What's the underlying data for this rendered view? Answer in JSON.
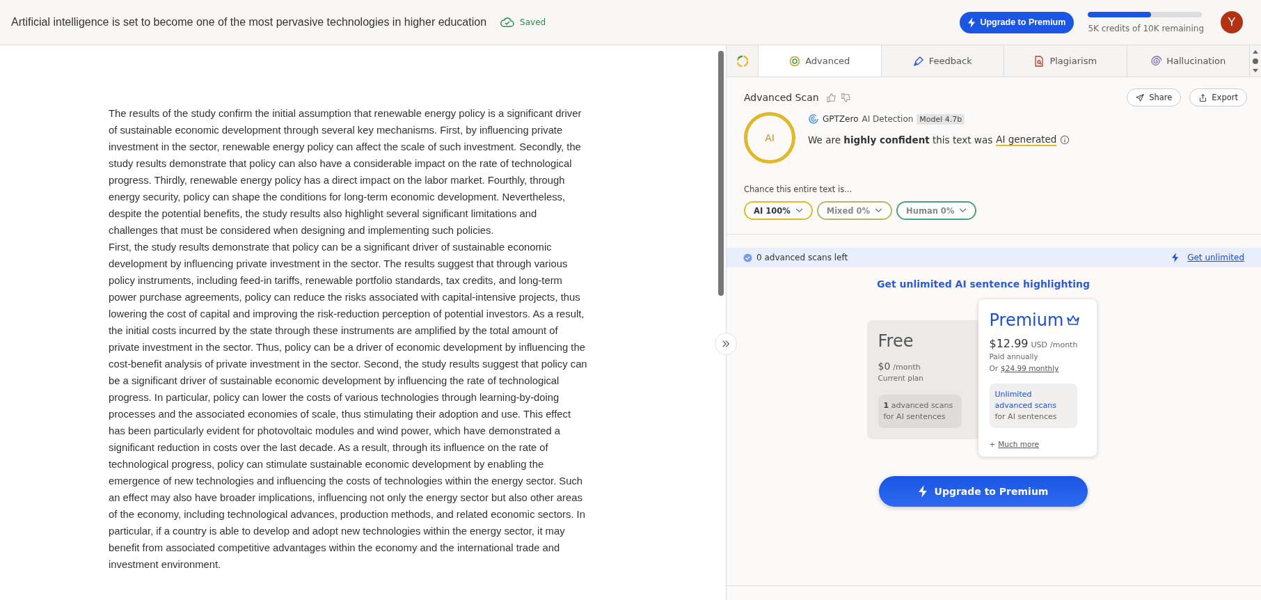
{
  "header": {
    "title": "Artificial intelligence is set to become one of the most pervasive technologies in higher education",
    "saved": "Saved",
    "upgrade": "Upgrade to Premium",
    "credits": {
      "level": 0.55,
      "label": "5K credits of 10K remaining"
    },
    "avatar": "Y"
  },
  "document": {
    "paragraphs": [
      "The results of the study confirm the initial assumption that renewable energy policy is a significant driver of sustainable economic development through several key mechanisms. First, by influencing private investment in the sector, renewable energy policy can affect the scale of such investment. Secondly, the study results demonstrate that policy can also have a considerable impact on the rate of technological progress. Thirdly, renewable energy policy has a direct impact on the labor market. Fourthly, through energy security, policy can shape the conditions for long-term economic development. Nevertheless, despite the potential benefits, the study results also highlight several significant limitations and challenges that must be considered when designing and implementing such policies.",
      "First, the study results demonstrate that policy can be a significant driver of sustainable economic development by influencing private investment in the sector. The results suggest that through various policy instruments, including feed-in tariffs, renewable portfolio standards, tax credits, and long-term power purchase agreements, policy can reduce the risks associated with capital-intensive projects, thus lowering the cost of capital and improving the risk-reduction perception of potential investors. As a result, the initial costs incurred by the state through these instruments are amplified by the total amount of private investment in the sector. Thus, policy can be a driver of economic development by influencing the cost-benefit analysis of private investment in the sector. Second, the study results suggest that policy can be a significant driver of sustainable economic development by influencing the rate of technological progress. In particular, policy can lower the costs of various technologies through learning-by-doing processes and the associated economies of scale, thus stimulating their adoption and use. This effect has been particularly evident for photovoltaic modules and wind power, which have demonstrated a significant reduction in costs over the last decade. As a result, through its influence on the rate of technological progress, policy can stimulate sustainable economic development by enabling the emergence of new technologies and influencing the costs of technologies within the energy sector. Such an effect may also have broader implications, influencing not only the energy sector but also other areas of the economy, including technological advances, production methods, and related economic sectors. In particular, if a country is able to develop and adopt new technologies within the energy sector, it may benefit from associated competitive advantages within the economy and the international trade and investment environment."
    ]
  },
  "tabs": [
    {
      "kind": "advanced",
      "label": "Advanced",
      "selected": true
    },
    {
      "kind": "feedback",
      "label": "Feedback",
      "selected": false
    },
    {
      "kind": "plagiarism",
      "label": "Plagiarism",
      "selected": false
    },
    {
      "kind": "hallucination",
      "label": "Hallucination",
      "selected": false
    }
  ],
  "scan": {
    "title": "Advanced Scan",
    "share": "Share",
    "export": "Export",
    "badge": "AI",
    "detector": "GPTZero",
    "detector_suffix": "AI Detection",
    "model": "Model 4.7b",
    "verdict_prefix": "We are **highly confident** this text was",
    "verdict": "AI generated",
    "chance_label": "Chance this entire text is...",
    "chances": [
      {
        "label": "AI 100%",
        "color": "#e0b82a",
        "selected": true
      },
      {
        "label": "Mixed 0%",
        "color": "#b9b46a",
        "selected": false
      },
      {
        "label": "Human 0%",
        "color": "#4aa37c",
        "selected": false
      }
    ]
  },
  "banner": {
    "text": "0 advanced scans left",
    "link": "Get unlimited"
  },
  "pricing": {
    "heading": "Get unlimited AI sentence highlighting",
    "plans": [
      {
        "name": "Free",
        "price": "$0",
        "period": "/month",
        "note": "Current plan",
        "feature_count": "1",
        "feature": "advanced scans",
        "feature_rest": "for AI sentences",
        "selected": false
      },
      {
        "name": "Premium",
        "price": "$12.99",
        "currency": "USD",
        "period": "/month",
        "note": "Paid annually",
        "alt_prefix": "Or",
        "alt_link": "$24.99 monthly",
        "feature": "Unlimited advanced scans",
        "feature_rest": "for AI sentences",
        "more_prefix": "+",
        "more": "Much more",
        "selected": true
      }
    ],
    "cta": "Upgrade to Premium"
  }
}
